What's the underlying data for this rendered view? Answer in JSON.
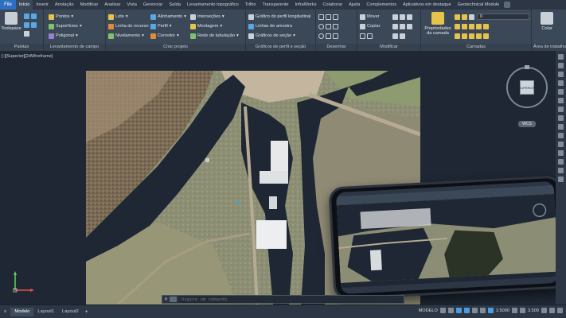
{
  "tabs": {
    "file": "File",
    "items": [
      "Início",
      "Inserir",
      "Anotação",
      "Modificar",
      "Analisar",
      "Vista",
      "Gerenciar",
      "Saída",
      "Levantamento topográfico",
      "Trilho",
      "Transparente",
      "InfraWorks",
      "Colaborar",
      "Ajuda",
      "Complementos",
      "Aplicativos em destaque",
      "Geotechnical Module"
    ]
  },
  "ribbon": {
    "toolspace": "Toolspace",
    "paletas": "Paletas",
    "levantamento": {
      "title": "Levantamento de campo",
      "items": [
        "Pontos",
        "Superfícies",
        "Poligonal"
      ]
    },
    "criar": {
      "title": "Criar projeto",
      "items": [
        "Lote",
        "Linha do recurso",
        "Nivelamento",
        "Alinhamento",
        "Perfil",
        "Corredor",
        "Interseções",
        "Montagem",
        "Rede de tubulação"
      ]
    },
    "perfil": {
      "title": "Gráficos de perfil e seção",
      "items": [
        "Gráfico do perfil longitudinal",
        "Linhas de amostra",
        "Gráficos de seção"
      ]
    },
    "desenhar": {
      "title": "Desenhar"
    },
    "modificar": {
      "title": "Modificar",
      "items": [
        "Mover",
        "Copiar"
      ]
    },
    "camadas": {
      "title": "Camadas",
      "big": "Propriedades da camada",
      "layer_value": "0"
    },
    "colar": "Colar",
    "area_trabalho": "Área de trabalho"
  },
  "viewport": {
    "label": "[-][Superior][2dWireframe]",
    "viewcube_face": "SUPERIOR",
    "wcs": "WCS"
  },
  "command": {
    "close": "✕",
    "placeholder": "Digite um comando"
  },
  "status": {
    "layouts": [
      "Modelo",
      "Layout1",
      "Layout2"
    ],
    "add": "+",
    "modelo": "MODELO",
    "scale": "1:5000",
    "value": "3.500"
  },
  "colors": {
    "ribbon_bg": "#3b4858",
    "canvas_bg": "#1e2733",
    "accent": "#2f6fbf"
  }
}
